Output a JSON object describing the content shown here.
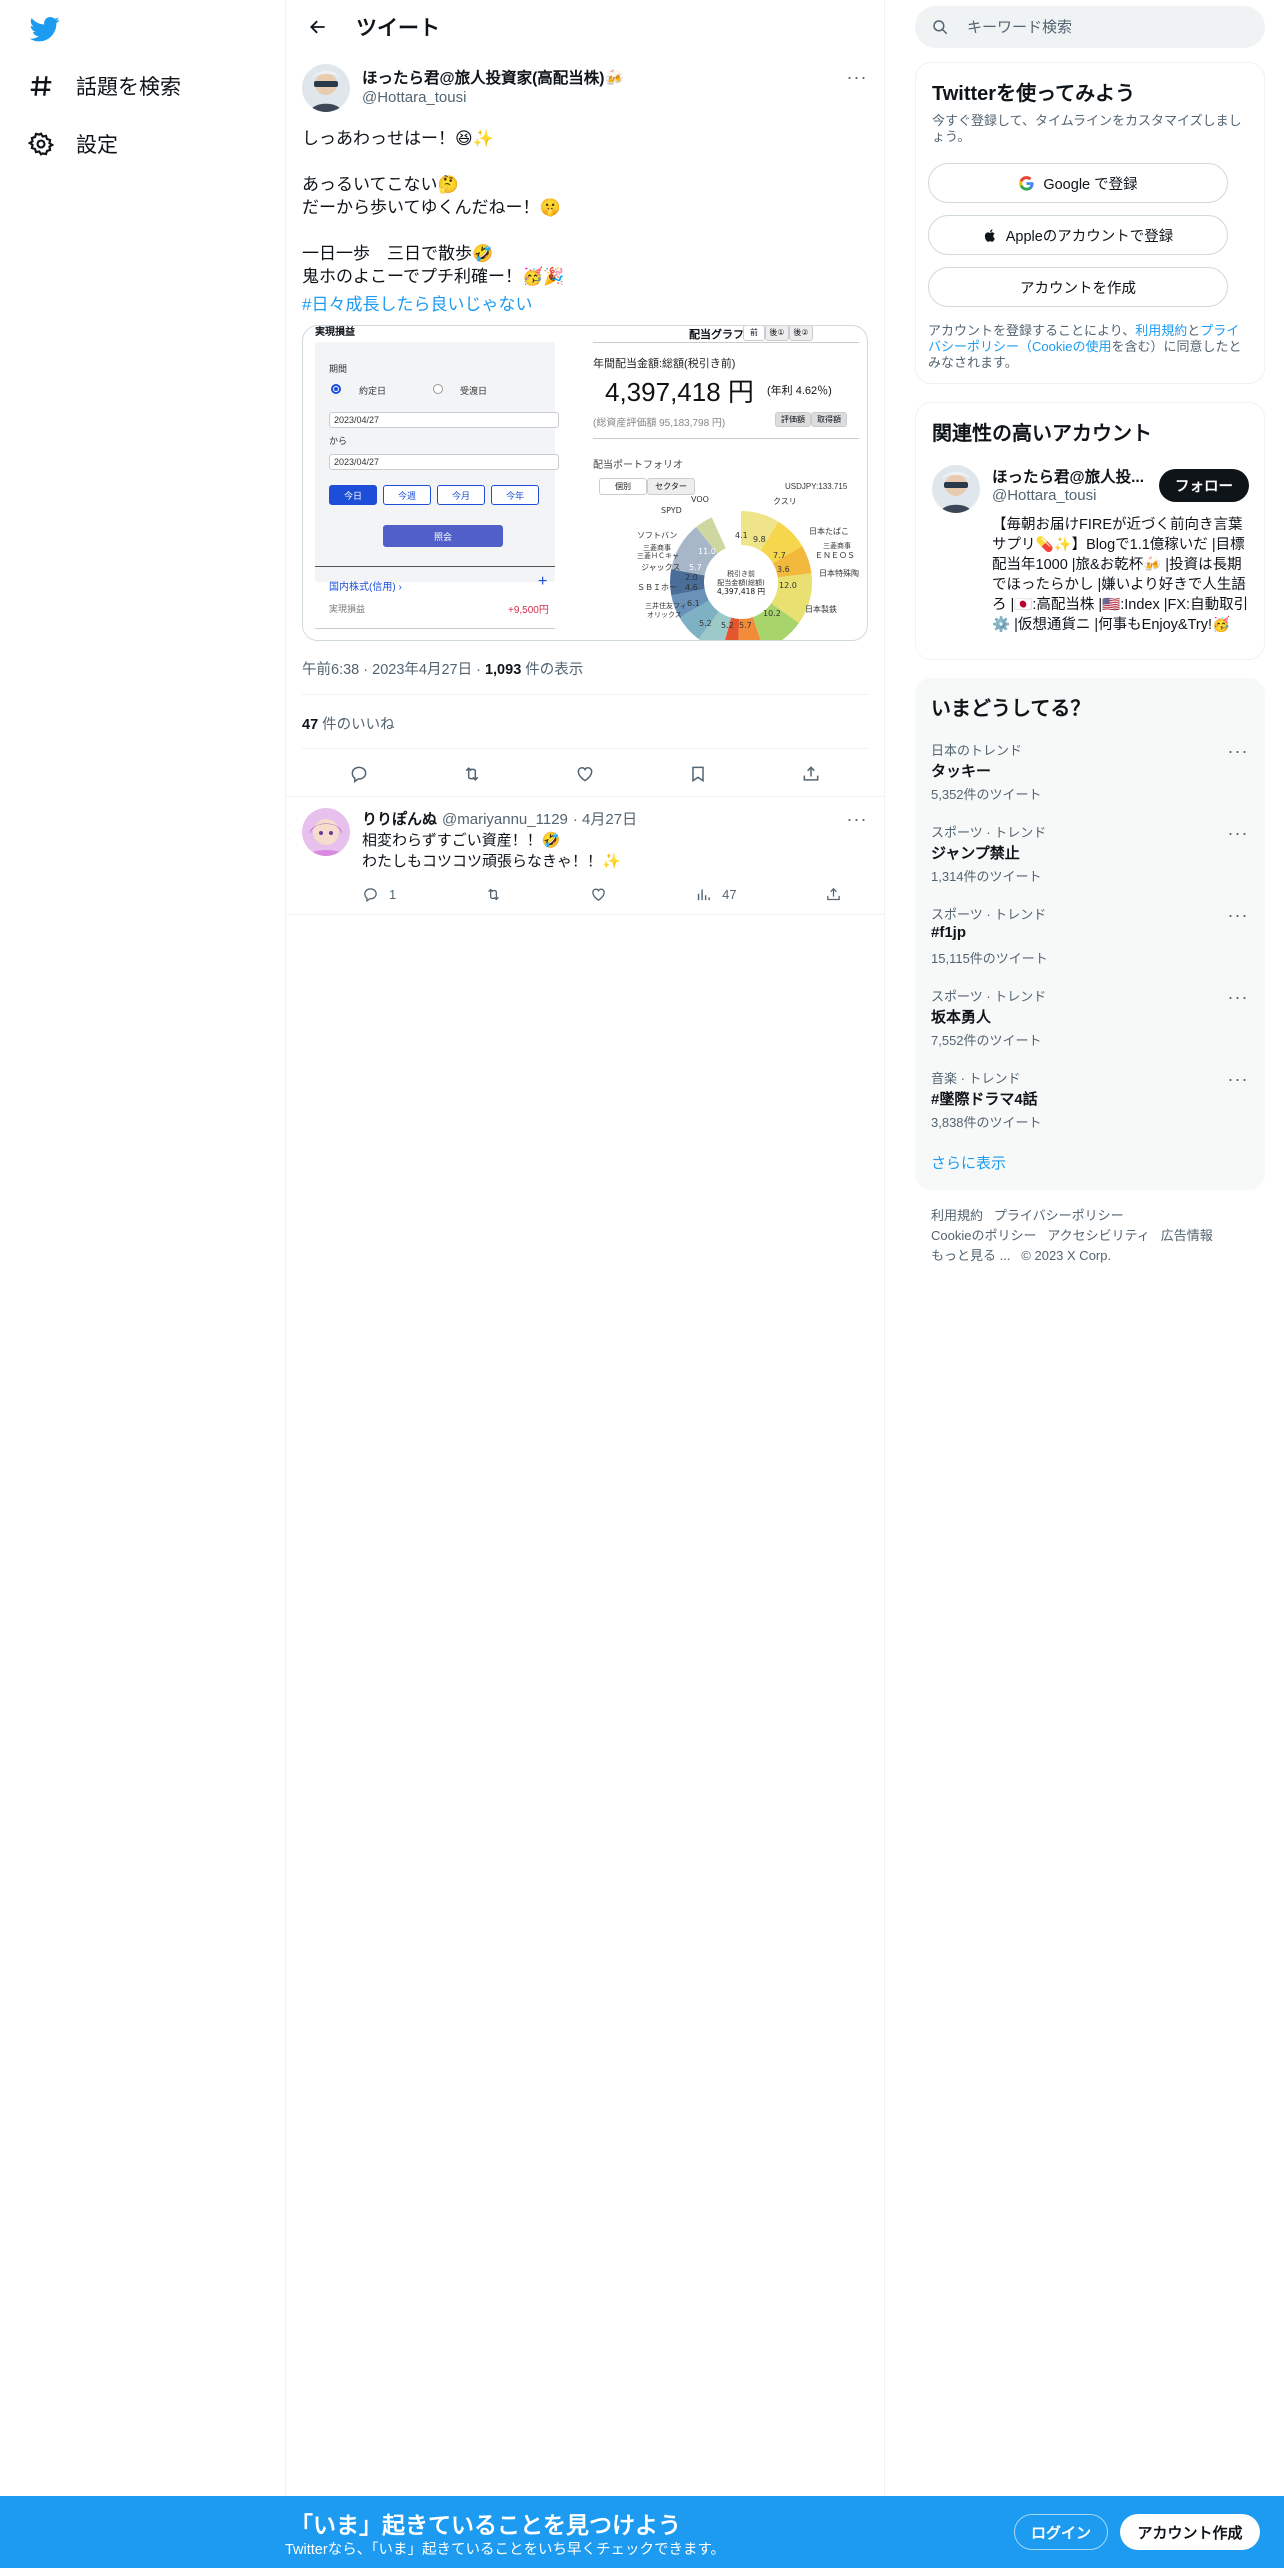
{
  "nav": {
    "items": [
      {
        "label": "話題を検索",
        "icon": "hashtag-icon"
      },
      {
        "label": "設定",
        "icon": "gear-icon"
      }
    ]
  },
  "header": {
    "title": "ツイート"
  },
  "tweet": {
    "author_name": "ほったら君@旅人投資家(高配当株)🍻",
    "author_handle": "@Hottara_tousi",
    "text": "しっあわっせはー！😆✨\n\nあっるいてこない🤔\nだーから歩いてゆくんだねー！🤫\n\n一日一歩　三日で散歩🤣\n鬼ホのよこーでプチ利確ー！🥳🎉",
    "hashtag": "#日々成長したら良いじゃない",
    "time": "午前6:38",
    "date": "2023年4月27日",
    "views_count": "1,093",
    "views_label": "件の表示",
    "likes_count": "47",
    "likes_label": "件のいいね"
  },
  "media": {
    "left_title": "実現損益",
    "period_label": "期間",
    "radio_1": "約定日",
    "radio_2": "受渡日",
    "date_1": "2023/04/27",
    "from_label": "から",
    "date_2": "2023/04/27",
    "btn_today": "今日",
    "btn_week": "今週",
    "btn_month": "今月",
    "btn_year": "今年",
    "btn_query": "照会",
    "domestic": "国内株式(信用) ›",
    "realized_label": "実現損益",
    "realized_value": "+9,500円",
    "graph_title": "配当グラフ",
    "tab_1": "前",
    "tab_2": "後①",
    "tab_3": "後②",
    "annual_label": "年間配当金額:総額(税引き前)",
    "annual_value": "4,397,418 円",
    "annual_rate": "(年利 4.62％)",
    "asset_value": "(総資産評価額 95,183,798 円)",
    "btn_eval": "評価額",
    "btn_cost": "取得額",
    "portfolio_label": "配当ポートフォリオ",
    "tab_indiv": "個別",
    "tab_sector": "セクター",
    "usdjpy": "USDJPY:133.715",
    "donut_center_1": "税引き前",
    "donut_center_2": "配当金額(総額)",
    "donut_center_3": "4,397,418 円",
    "labels": [
      "VOO",
      "SPYD",
      "ソフトバン",
      "三菱商事",
      "三菱ＨＣキャ",
      "ジャックス",
      "ＳＢＩホー",
      "三井住友フィ",
      "オリックス",
      "日本たばこ",
      "日本特殊陶",
      "日本製鉄",
      "ＥＮＥＯＳ",
      "クスリ",
      "三菱商事"
    ],
    "values": [
      "4.1",
      "11.0",
      "5.7",
      "2.0",
      "4.6",
      "6.1",
      "5.2",
      "9.8",
      "7.7",
      "12.0",
      "10.2",
      "5.7",
      "5.2",
      "3.6"
    ]
  },
  "actions": {
    "reply": "reply-icon",
    "retweet": "retweet-icon",
    "like": "heart-icon",
    "bookmark": "bookmark-icon",
    "share": "share-icon"
  },
  "reply_tweet": {
    "author_name": "りりぽんぬ",
    "author_handle": "@mariyannu_1129",
    "date": "· 4月27日",
    "text": "相変わらずすごい資産！！🤣\nわたしもコツコツ頑張らなきゃ！！✨",
    "reply_count": "1",
    "views_count": "47"
  },
  "search": {
    "placeholder": "キーワード検索"
  },
  "signup_card": {
    "title": "Twitterを使ってみよう",
    "subtitle": "今すぐ登録して、タイムラインをカスタマイズしましょう。",
    "google_btn": "Google で登録",
    "apple_btn": "Appleのアカウントで登録",
    "create_btn": "アカウントを作成",
    "note_1": "アカウントを登録することにより、",
    "note_link_1": "利用規約",
    "note_2": "と",
    "note_link_2": "プライバシーポリシー（Cookieの使用",
    "note_3": "を含む）に同意したとみなされます。"
  },
  "related": {
    "title": "関連性の高いアカウント",
    "name": "ほったら君@旅人投...",
    "handle": "@Hottara_tousi",
    "follow_btn": "フォロー",
    "bio": "【毎朝お届けFIREが近づく前向き言葉サプリ💊✨】Blogで1.1億稼いだ |目標配当年1000 |旅&お乾杯🍻 |投資は長期でほったらかし |嫌いより好きで人生語ろ |🇯🇵:高配当株 |🇺🇸:Index |FX:自動取引⚙️ |仮想通貨ニ |何事もEnjoy&Try!🥳"
  },
  "trends": {
    "title": "いまどうしてる？",
    "items": [
      {
        "category": "日本のトレンド",
        "name": "タッキー",
        "count": "5,352件のツイート"
      },
      {
        "category": "スポーツ · トレンド",
        "name": "ジャンプ禁止",
        "count": "1,314件のツイート"
      },
      {
        "category": "スポーツ · トレンド",
        "name": "#f1jp",
        "count": "15,115件のツイート"
      },
      {
        "category": "スポーツ · トレンド",
        "name": "坂本勇人",
        "count": "7,552件のツイート"
      },
      {
        "category": "音楽 · トレンド",
        "name": "#墜際ドラマ4話",
        "count": "3,838件のツイート"
      }
    ],
    "show_more": "さらに表示"
  },
  "footer": {
    "terms": "利用規約",
    "privacy": "プライバシーポリシー",
    "cookie": "Cookieのポリシー",
    "accessibility": "アクセシビリティ",
    "ads": "広告情報",
    "more": "もっと見る ...",
    "copyright": "© 2023 X Corp."
  },
  "bottom_bar": {
    "title": "「いま」起きていることを見つけよう",
    "subtitle": "Twitterなら、「いま」起きていることをいち早くチェックできます。",
    "login": "ログイン",
    "signup": "アカウント作成"
  },
  "colors": {
    "accent": "#1d9bf0",
    "text": "#0f1419",
    "muted": "#536471",
    "border": "#eff3f4"
  }
}
